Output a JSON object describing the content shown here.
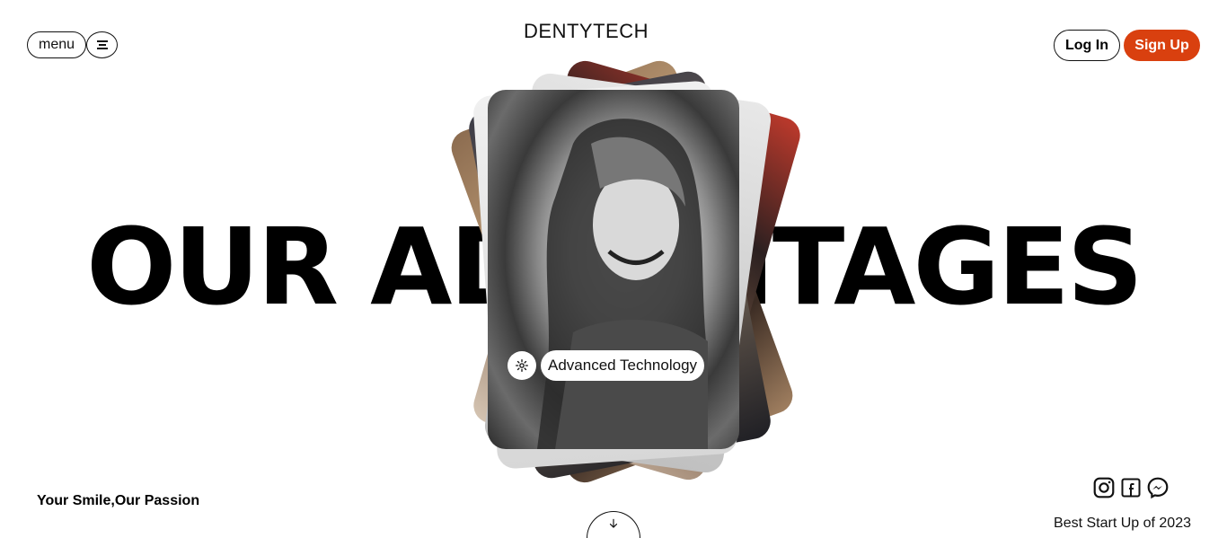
{
  "header": {
    "menu_label": "menu",
    "brand": "DENTYTECH",
    "login_label": "Log In",
    "signup_label": "Sign Up"
  },
  "hero": {
    "headline": "OUR ADVANTAGES",
    "card_tag": "Advanced Technology",
    "card_icon": "gear-icon"
  },
  "footer": {
    "tagline": "Your Smile,Our Passion",
    "award": "Best Start Up of 2023",
    "social_icons": [
      "instagram-icon",
      "facebook-icon",
      "messenger-icon"
    ]
  },
  "colors": {
    "accent": "#d9400f",
    "text": "#000000",
    "background": "#ffffff"
  }
}
